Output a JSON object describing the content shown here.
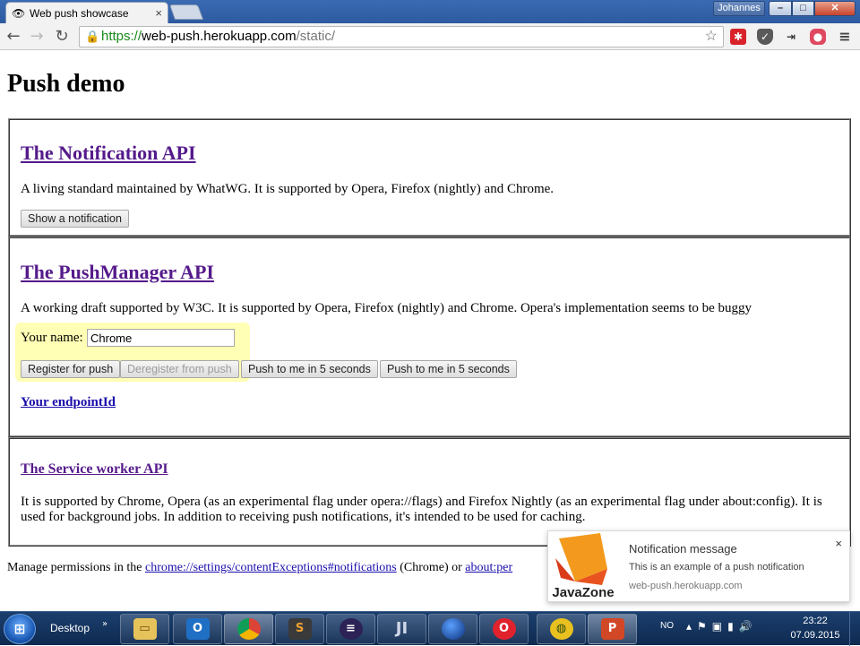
{
  "browser": {
    "tab_title": "Web push showcase",
    "tab_close": "×",
    "user_name": "Johannes",
    "url_scheme": "https://",
    "url_host": "web-push.herokuapp.com",
    "url_path": "/static/"
  },
  "page": {
    "title": "Push demo",
    "notification_section": {
      "heading": "The Notification API",
      "description": "A living standard maintained by WhatWG. It is supported by Opera, Firefox (nightly) and Chrome.",
      "show_button": "Show a notification"
    },
    "pushmanager_section": {
      "heading": "The PushManager API",
      "description": "A working draft supported by W3C. It is supported by Opera, Firefox (nightly) and Chrome. Opera's implementation seems to be buggy",
      "name_label": "Your name:",
      "name_value": "Chrome",
      "register_button": "Register for push",
      "deregister_button": "Deregister from push",
      "push_button_1": "Push to me in 5 seconds",
      "push_button_2": "Push to me in 5 seconds",
      "endpoint_link": "Your endpointId"
    },
    "serviceworker_section": {
      "heading": "The Service worker API",
      "description": "It is supported by Chrome, Opera (as an experimental flag under opera://flags) and Firefox Nightly (as an experimental flag under about:config). It is used for background jobs. In addition to receiving push notifications, it's intended to be used for caching."
    },
    "footer": {
      "prefix": "Manage permissions in the ",
      "chrome_link": "chrome://settings/contentExceptions#notifications",
      "middle": " (Chrome) or ",
      "other_link": "about:per"
    }
  },
  "notification_popup": {
    "logo_text": "JavaZone",
    "title": "Notification message",
    "body": "This is an example of a push notification",
    "source": "web-push.herokuapp.com",
    "close": "×"
  },
  "taskbar": {
    "desktop_label": "Desktop",
    "language": "NO",
    "time": "23:22",
    "date": "07.09.2015"
  },
  "colors": {
    "visited_link": "#551a8b",
    "link": "#1a0dab",
    "highlight": "#ffff78",
    "taskbar": "#1c3f6e"
  }
}
